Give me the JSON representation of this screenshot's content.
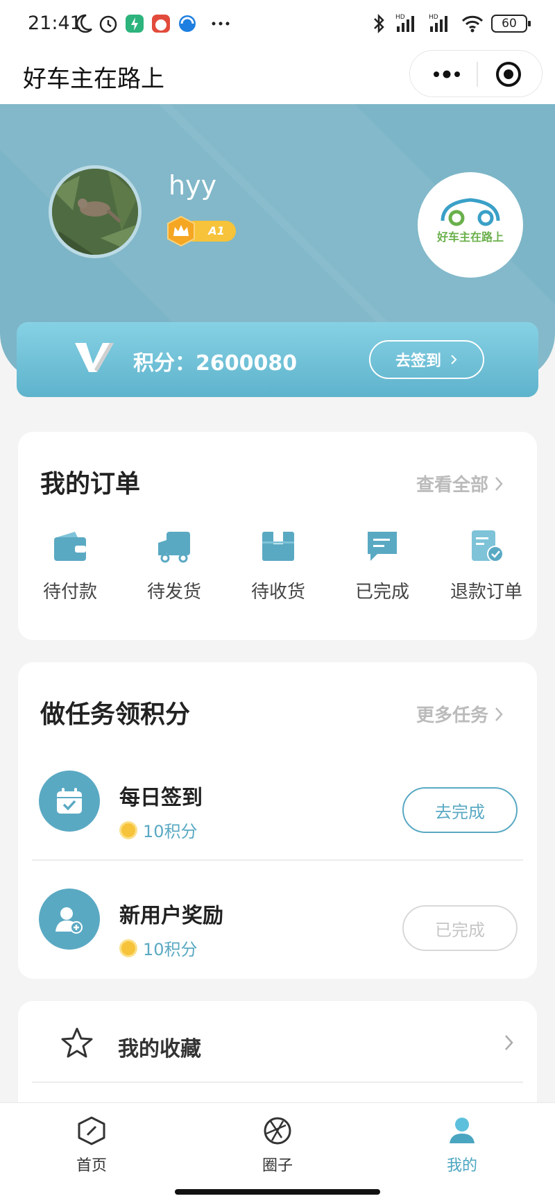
{
  "status_bar": {
    "time": "21:41",
    "battery": "60",
    "icons": [
      "moon-icon",
      "alarm-icon",
      "app-icon",
      "app-icon",
      "browser-icon",
      "more-icon",
      "bluetooth-icon",
      "signal-icon",
      "signal-icon",
      "wifi-icon",
      "battery-icon"
    ]
  },
  "titlebar": {
    "title": "好车主在路上",
    "icons": [
      "more-dots-icon",
      "close-target-icon"
    ]
  },
  "profile": {
    "username": "hyy",
    "badge_text": "A1",
    "logo_text": "好车主在路上"
  },
  "points": {
    "label": "积分：2600080",
    "checkin_button": "去签到"
  },
  "orders": {
    "title": "我的订单",
    "view_all": "查看全部",
    "items": [
      {
        "label": "待付款",
        "icon": "wallet-icon"
      },
      {
        "label": "待发货",
        "icon": "truck-icon"
      },
      {
        "label": "待收货",
        "icon": "box-icon"
      },
      {
        "label": "已完成",
        "icon": "message-icon"
      },
      {
        "label": "退款订单",
        "icon": "refund-doc-icon"
      }
    ]
  },
  "tasks": {
    "title": "做任务领积分",
    "more": "更多任务",
    "items": [
      {
        "name": "每日签到",
        "reward": "10积分",
        "button": "去完成",
        "icon": "calendar-check-icon",
        "state": "active"
      },
      {
        "name": "新用户奖励",
        "reward": "10积分",
        "button": "已完成",
        "icon": "user-add-icon",
        "state": "done"
      }
    ]
  },
  "menu": {
    "favorites": "我的收藏"
  },
  "tabbar": {
    "tabs": [
      {
        "label": "首页",
        "icon": "home-compass-icon"
      },
      {
        "label": "圈子",
        "icon": "aperture-icon"
      },
      {
        "label": "我的",
        "icon": "user-icon"
      }
    ],
    "active_index": 2
  },
  "colors": {
    "accent": "#5aa9c3",
    "header_bg": "#7cb5c7",
    "gold": "#f6c33a"
  }
}
